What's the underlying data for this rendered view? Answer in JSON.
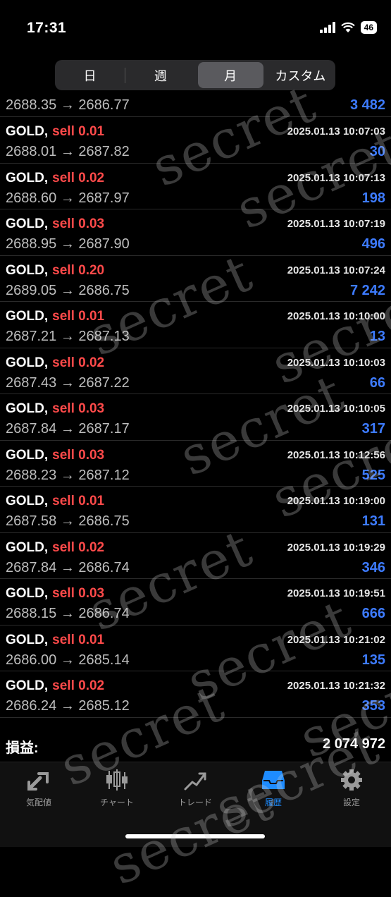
{
  "status_bar": {
    "time": "17:31",
    "battery": "46"
  },
  "segments": [
    {
      "label": "日",
      "active": false
    },
    {
      "label": "週",
      "active": false
    },
    {
      "label": "月",
      "active": true
    },
    {
      "label": "カスタム",
      "active": false
    }
  ],
  "first_row": {
    "price_range": "2688.35 → 2686.77",
    "profit": "3 482"
  },
  "trades": [
    {
      "symbol": "GOLD,",
      "type": "sell 0.01",
      "timestamp": "2025.01.13 10:07:03",
      "price_range": "2688.01 → 2687.82",
      "profit": "30"
    },
    {
      "symbol": "GOLD,",
      "type": "sell 0.02",
      "timestamp": "2025.01.13 10:07:13",
      "price_range": "2688.60 → 2687.97",
      "profit": "198"
    },
    {
      "symbol": "GOLD,",
      "type": "sell 0.03",
      "timestamp": "2025.01.13 10:07:19",
      "price_range": "2688.95 → 2687.90",
      "profit": "496"
    },
    {
      "symbol": "GOLD,",
      "type": "sell 0.20",
      "timestamp": "2025.01.13 10:07:24",
      "price_range": "2689.05 → 2686.75",
      "profit": "7 242"
    },
    {
      "symbol": "GOLD,",
      "type": "sell 0.01",
      "timestamp": "2025.01.13 10:10:00",
      "price_range": "2687.21 → 2687.13",
      "profit": "13"
    },
    {
      "symbol": "GOLD,",
      "type": "sell 0.02",
      "timestamp": "2025.01.13 10:10:03",
      "price_range": "2687.43 → 2687.22",
      "profit": "66"
    },
    {
      "symbol": "GOLD,",
      "type": "sell 0.03",
      "timestamp": "2025.01.13 10:10:05",
      "price_range": "2687.84 → 2687.17",
      "profit": "317"
    },
    {
      "symbol": "GOLD,",
      "type": "sell 0.03",
      "timestamp": "2025.01.13 10:12:56",
      "price_range": "2688.23 → 2687.12",
      "profit": "525"
    },
    {
      "symbol": "GOLD,",
      "type": "sell 0.01",
      "timestamp": "2025.01.13 10:19:00",
      "price_range": "2687.58 → 2686.75",
      "profit": "131"
    },
    {
      "symbol": "GOLD,",
      "type": "sell 0.02",
      "timestamp": "2025.01.13 10:19:29",
      "price_range": "2687.84 → 2686.74",
      "profit": "346"
    },
    {
      "symbol": "GOLD,",
      "type": "sell 0.03",
      "timestamp": "2025.01.13 10:19:51",
      "price_range": "2688.15 → 2686.74",
      "profit": "666"
    },
    {
      "symbol": "GOLD,",
      "type": "sell 0.01",
      "timestamp": "2025.01.13 10:21:02",
      "price_range": "2686.00 → 2685.14",
      "profit": "135"
    },
    {
      "symbol": "GOLD,",
      "type": "sell 0.02",
      "timestamp": "2025.01.13 10:21:32",
      "price_range": "2686.24 → 2685.12",
      "profit": "353"
    }
  ],
  "total": {
    "label": "損益:",
    "value": "2 074 972"
  },
  "tabs": [
    {
      "label": "気配値",
      "icon": "quotes-icon",
      "active": false
    },
    {
      "label": "チャート",
      "icon": "chart-icon",
      "active": false
    },
    {
      "label": "トレード",
      "icon": "trade-icon",
      "active": false
    },
    {
      "label": "履歴",
      "icon": "history-icon",
      "active": true
    },
    {
      "label": "設定",
      "icon": "gear-icon",
      "active": false
    }
  ],
  "watermark": "secret",
  "colors": {
    "sell": "#ff4a4a",
    "profit": "#3d7bff",
    "active_tab": "#1e8cff"
  }
}
